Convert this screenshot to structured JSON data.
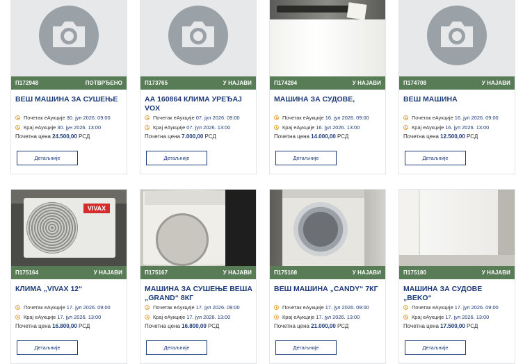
{
  "labels": {
    "start": "Почетак еАукције",
    "end": "Крај еАукције",
    "price": "Почетна цена",
    "details": "Детаљније"
  },
  "currency": "РСД",
  "accent": "#587c55",
  "title_color": "#1c3a78",
  "clock_color": "#e5a646",
  "items": [
    {
      "code": "П172948",
      "status": "ПОТВРЂЕНО",
      "title": "ВЕШ МАШИНА ЗА СУШЕЊЕ",
      "start": "30. јун 2026. 09:00",
      "end": "30. јун 2026. 13:00",
      "price": "24.500,00",
      "image": "camera-placeholder-icon"
    },
    {
      "code": "П173765",
      "status": "У НАЈАВИ",
      "title": "АА 160864 КЛИМА УРЕЂАЈ VOX",
      "start": "07. јул 2026. 09:00",
      "end": "07. јул 2026. 13:00",
      "price": "7.000,00",
      "image": "camera-placeholder-icon"
    },
    {
      "code": "П174284",
      "status": "У НАЈАВИ",
      "title": "МАШИНА ЗА СУДОВЕ,",
      "start": "16. јул 2026. 09:00",
      "end": "16. јул 2026. 13:00",
      "price": "14.000,00",
      "image": "dishwasher-photo"
    },
    {
      "code": "П174708",
      "status": "У НАЈАВИ",
      "title": "ВЕШ МАШИНА",
      "start": "16. јул 2026. 09:00",
      "end": "16. јул 2026. 13:00",
      "price": "12.500,00",
      "image": "camera-placeholder-icon"
    },
    {
      "code": "П175164",
      "status": "У НАЈАВИ",
      "title": "КЛИМА „VIVAX 12“",
      "start": "17. јул 2026. 09:00",
      "end": "17. јул 2026. 13:00",
      "price": "16.800,00",
      "image": "ac-unit-photo",
      "logo": "VIVAX"
    },
    {
      "code": "П175167",
      "status": "У НАЈАВИ",
      "title": "МАШИНА ЗА СУШЕЊЕ ВЕША „GRAND“ 8КГ",
      "start": "17. јул 2026. 09:00",
      "end": "17. јул 2026. 13:00",
      "price": "16.800,00",
      "image": "dryer-photo"
    },
    {
      "code": "П175168",
      "status": "У НАЈАВИ",
      "title": "ВЕШ МАШИНА „CANDY“ 7КГ",
      "start": "17. јул 2026. 09:00",
      "end": "17. јул 2026. 13:00",
      "price": "21.000,00",
      "image": "washing-machine-photo"
    },
    {
      "code": "П175180",
      "status": "У НАЈАВИ",
      "title": "МАШИНА ЗА СУДОВЕ „BEKO“",
      "start": "17. јул 2026. 09:00",
      "end": "17. јул 2026. 13:00",
      "price": "17.500,00",
      "image": "dishwasher-room-photo"
    }
  ]
}
